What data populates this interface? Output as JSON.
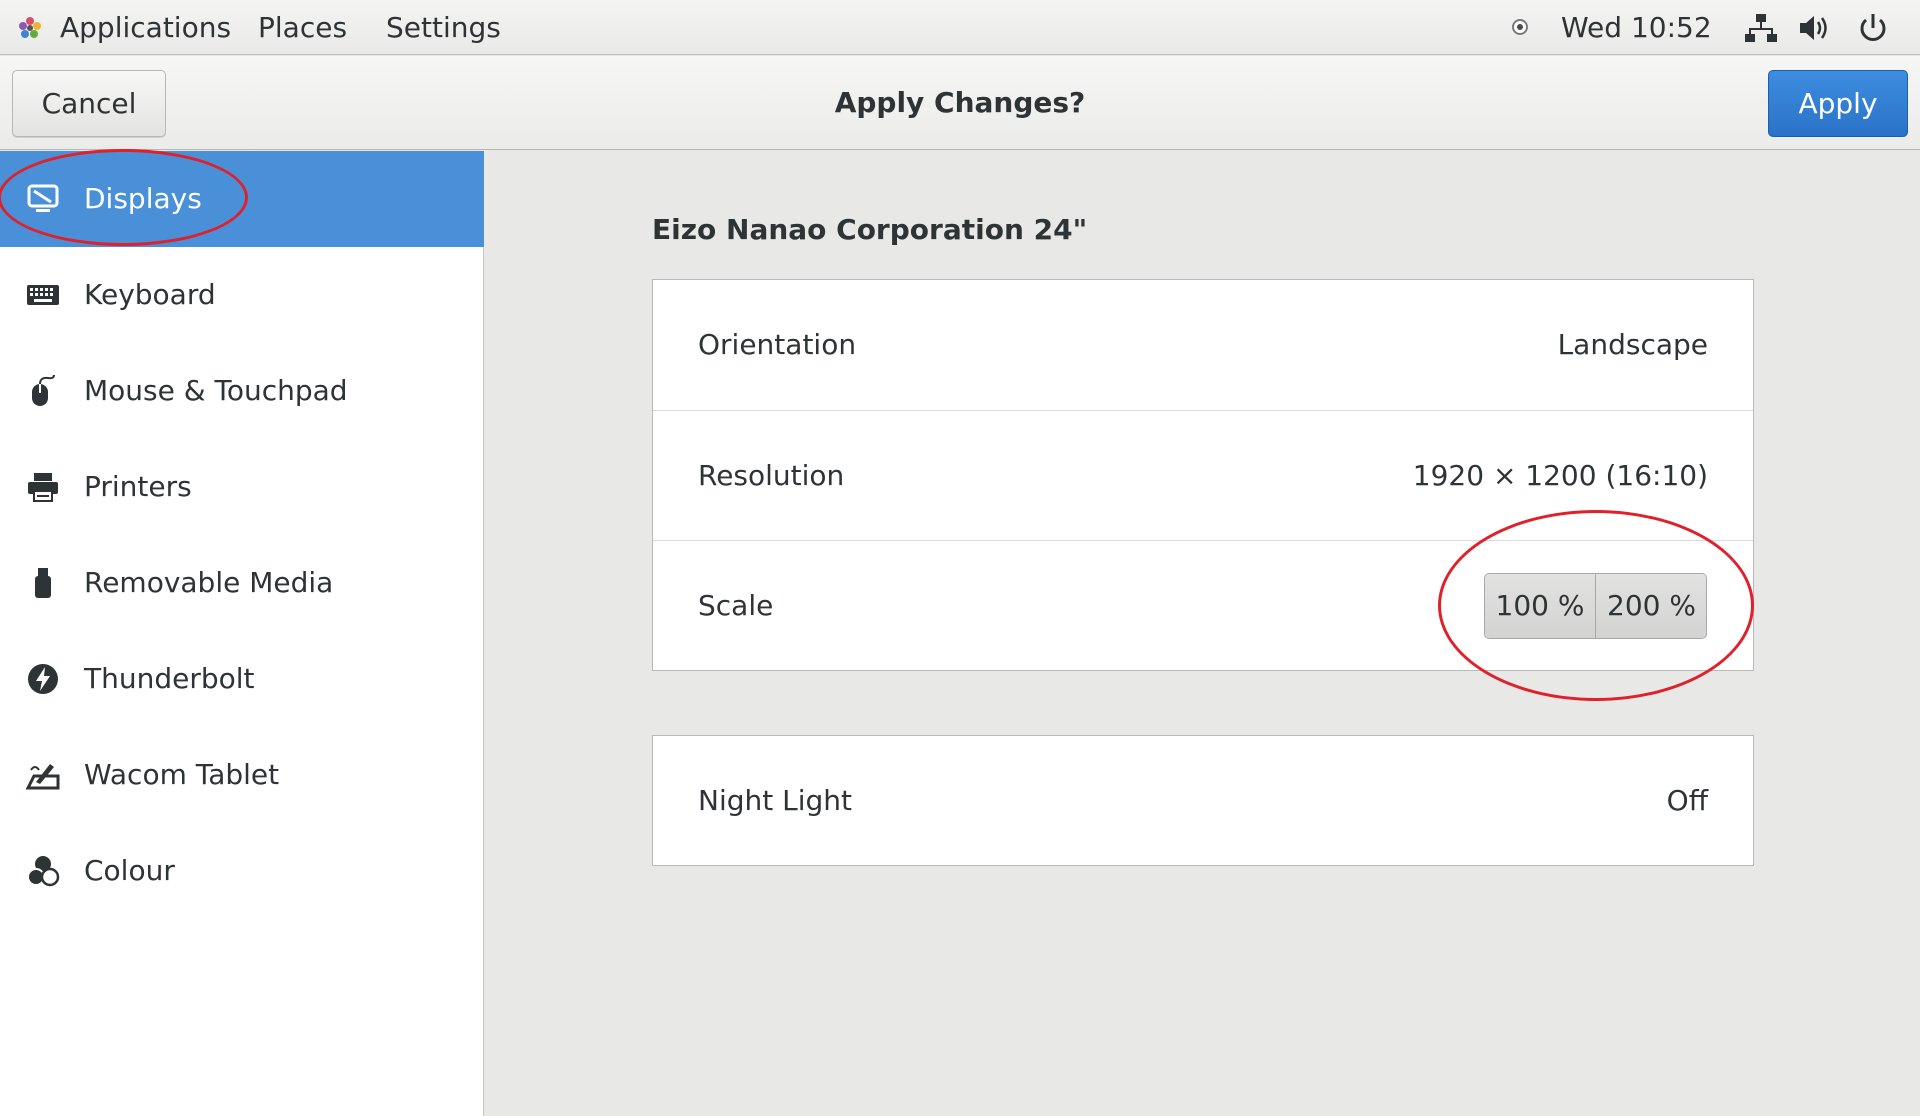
{
  "top_panel": {
    "menus": [
      "Applications",
      "Places",
      "Settings"
    ],
    "clock": "Wed 10:52",
    "icons": [
      "apps-logo-icon",
      "tray-indicator-icon",
      "network-icon",
      "volume-icon",
      "power-icon"
    ]
  },
  "header": {
    "cancel_label": "Cancel",
    "title": "Apply Changes?",
    "apply_label": "Apply",
    "apply_color": "#2a72c8"
  },
  "sidebar": {
    "items": [
      {
        "label": "Displays",
        "icon": "display-icon",
        "selected": true
      },
      {
        "label": "Keyboard",
        "icon": "keyboard-icon"
      },
      {
        "label": "Mouse & Touchpad",
        "icon": "mouse-icon"
      },
      {
        "label": "Printers",
        "icon": "printer-icon"
      },
      {
        "label": "Removable Media",
        "icon": "usb-drive-icon"
      },
      {
        "label": "Thunderbolt",
        "icon": "thunderbolt-icon"
      },
      {
        "label": "Wacom Tablet",
        "icon": "tablet-icon"
      },
      {
        "label": "Colour",
        "icon": "colour-icon"
      }
    ],
    "selected_color": "#4a90d9"
  },
  "main": {
    "monitor_name": "Eizo Nanao Corporation 24\"",
    "rows": [
      {
        "label": "Orientation",
        "value": "Landscape"
      },
      {
        "label": "Resolution",
        "value": "1920 × 1200 (16:10)"
      },
      {
        "label": "Scale",
        "options": [
          "100 %",
          "200 %"
        ]
      }
    ],
    "night_light": {
      "label": "Night Light",
      "value": "Off"
    }
  },
  "annotations": {
    "color": "#e0202a",
    "circled": [
      "Displays",
      "Scale"
    ]
  }
}
